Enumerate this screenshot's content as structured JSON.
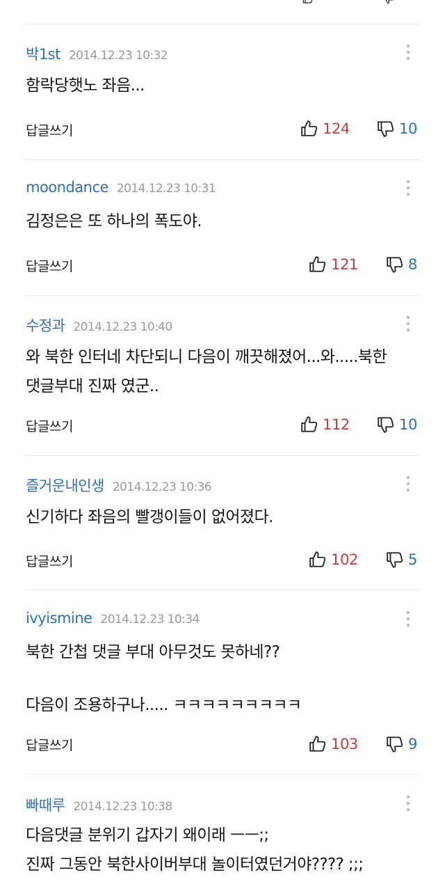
{
  "reply_label": "답글쓰기",
  "colors": {
    "author": "#2f6fb3",
    "timestamp": "#9a9a9a",
    "like_count": "#cc3b3b",
    "dislike_count": "#2f6fb3",
    "divider": "#e9e9e9"
  },
  "icons": {
    "like": "thumbs-up-icon",
    "dislike": "thumbs-down-icon",
    "more": "more-vertical-icon"
  },
  "comments": [
    {
      "author": "박1st",
      "timestamp": "2014.12.23 10:32",
      "lines": [
        "함락당햇노 좌음..."
      ],
      "likes": "124",
      "dislikes": "10"
    },
    {
      "author": "moondance",
      "timestamp": "2014.12.23 10:31",
      "lines": [
        "김정은은 또 하나의 폭도야."
      ],
      "likes": "121",
      "dislikes": "8"
    },
    {
      "author": "수정과",
      "timestamp": "2014.12.23 10:40",
      "lines": [
        "와 북한 인터네 차단되니 다음이 깨끗해졌어...와.....북한",
        "댓글부대 진짜 였군.."
      ],
      "likes": "112",
      "dislikes": "10"
    },
    {
      "author": "즐거운내인생",
      "timestamp": "2014.12.23 10:36",
      "lines": [
        "신기하다 좌음의 빨갱이들이 없어졌다."
      ],
      "likes": "102",
      "dislikes": "5"
    },
    {
      "author": "ivyismine",
      "timestamp": "2014.12.23 10:34",
      "lines": [
        "북한 간첩 댓글 부대 아무것도 못하네??",
        "",
        "다음이 조용하구나..... ㅋㅋㅋㅋㅋㅋㅋㅋㅋ"
      ],
      "likes": "103",
      "dislikes": "9"
    },
    {
      "author": "빠때루",
      "timestamp": "2014.12.23 10:38",
      "lines": [
        "다음댓글 분위기 갑자기 왜이래 ㅡㅡ;;",
        "진짜 그동안 북한사이버부대 놀이터였던거야???? ;;;"
      ]
    }
  ]
}
